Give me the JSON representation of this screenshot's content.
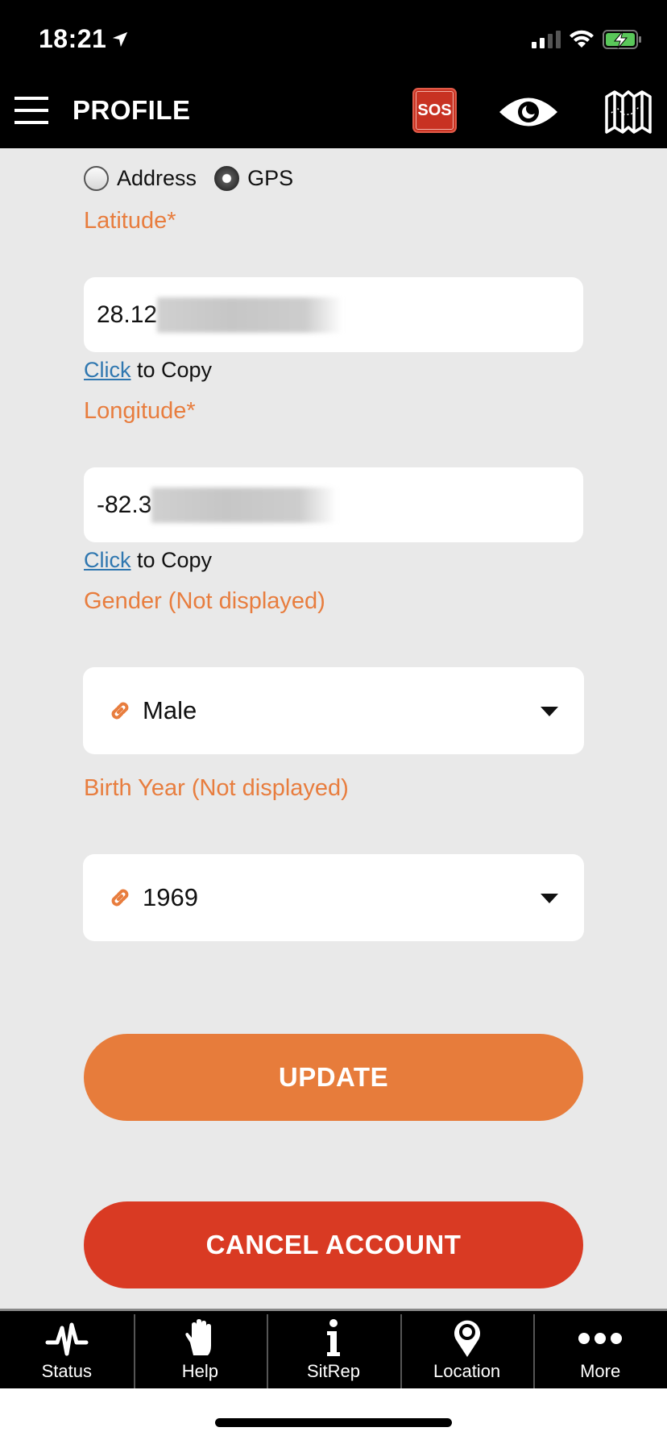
{
  "status_bar": {
    "time": "18:21",
    "location_icon": "location-arrow-icon",
    "signal_bars_active": 2,
    "signal_bars_total": 4,
    "wifi_icon": "wifi-icon",
    "battery_icon": "battery-charging-icon",
    "battery_color": "#5ac75a"
  },
  "header": {
    "menu_icon": "hamburger-menu-icon",
    "title": "PROFILE",
    "sos_label": "SOS",
    "sos_color": "#c83222",
    "eye_icon": "eye-icon",
    "map_icon": "map-icon"
  },
  "form": {
    "location_type": {
      "options": [
        {
          "label": "Address",
          "checked": false
        },
        {
          "label": "GPS",
          "checked": true
        }
      ]
    },
    "latitude": {
      "label": "Latitude*",
      "value_visible": "28.12",
      "value_obscured": true,
      "copy_link": "Click",
      "copy_text": " to Copy"
    },
    "longitude": {
      "label": "Longitude*",
      "value_visible": "-82.3",
      "value_obscured": true,
      "copy_link": "Click",
      "copy_text": " to Copy"
    },
    "gender": {
      "label": "Gender (Not displayed)",
      "icon": "link-icon",
      "value": "Male"
    },
    "birth_year": {
      "label": "Birth Year (Not displayed)",
      "icon": "link-icon",
      "value": "1969"
    },
    "label_color": "#e87d3e"
  },
  "actions": {
    "update_label": "UPDATE",
    "update_color": "#e77c3b",
    "cancel_label": "CANCEL ACCOUNT",
    "cancel_color": "#d93a23"
  },
  "tab_bar": {
    "tabs": [
      {
        "label": "Status",
        "icon": "pulse-icon"
      },
      {
        "label": "Help",
        "icon": "hand-icon"
      },
      {
        "label": "SitRep",
        "icon": "info-icon"
      },
      {
        "label": "Location",
        "icon": "map-pin-icon"
      },
      {
        "label": "More",
        "icon": "more-dots-icon"
      }
    ]
  }
}
